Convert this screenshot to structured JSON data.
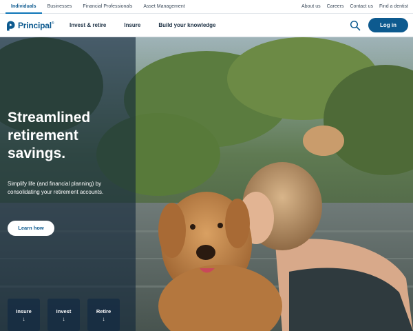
{
  "utility": {
    "tabs": [
      "Individuals",
      "Businesses",
      "Financial Professionals",
      "Asset Management"
    ],
    "links": [
      "About us",
      "Careers",
      "Contact us",
      "Find a dentist"
    ]
  },
  "nav": {
    "logo_text": "Principal",
    "logo_mark": "®",
    "items": [
      "Invest & retire",
      "Insure",
      "Build your knowledge"
    ],
    "search_icon": "search-icon",
    "login_label": "Log in"
  },
  "hero": {
    "title": "Streamlined retirement savings.",
    "text": "Simplify life (and financial planning) by consolidating your retirement accounts.",
    "cta_label": "Learn how",
    "quick_links": [
      {
        "label": "Insure",
        "arrow": "↓"
      },
      {
        "label": "Invest",
        "arrow": "↓"
      },
      {
        "label": "Retire",
        "arrow": "↓"
      }
    ]
  },
  "colors": {
    "brand_blue": "#0d5a8f",
    "panel_overlay": "#12263a"
  }
}
